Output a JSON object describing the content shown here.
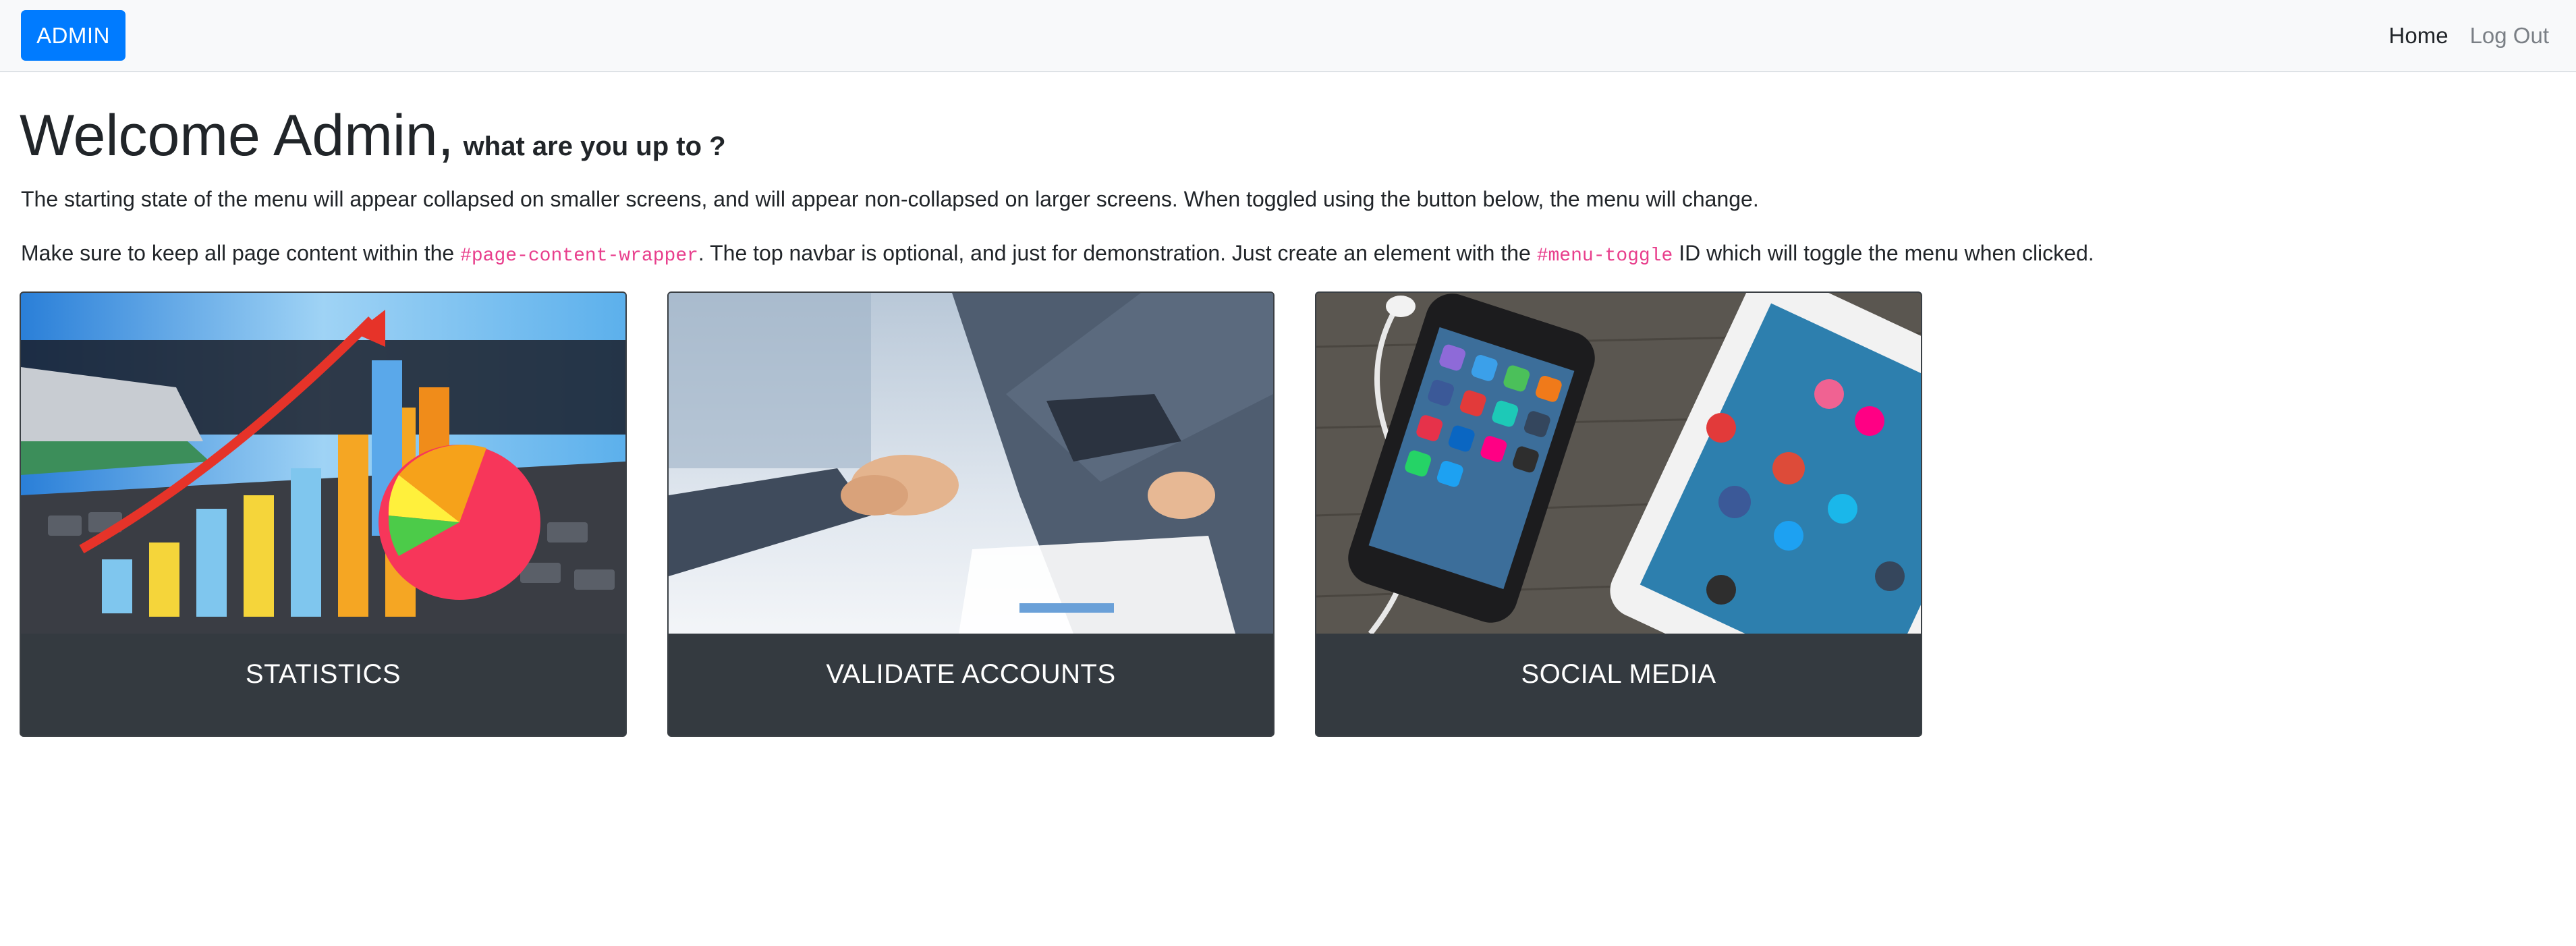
{
  "navbar": {
    "brand_button": "ADMIN",
    "links": [
      {
        "label": "Home"
      },
      {
        "label": "Log Out"
      }
    ]
  },
  "header": {
    "title": "Welcome Admin,",
    "subtitle": "what are you up to ?"
  },
  "intro": {
    "paragraph1": "The starting state of the menu will appear collapsed on smaller screens, and will appear non-collapsed on larger screens. When toggled using the button below, the menu will change.",
    "paragraph2_before": "Make sure to keep all page content within the ",
    "paragraph2_code1": "#page-content-wrapper",
    "paragraph2_middle": ". The top navbar is optional, and just for demonstration. Just create an element with the ",
    "paragraph2_code2": "#menu-toggle",
    "paragraph2_after": " ID which will toggle the menu when clicked."
  },
  "cards": [
    {
      "label": "STATISTICS",
      "image": "statistics-chart-illustration"
    },
    {
      "label": "VALIDATE ACCOUNTS",
      "image": "business-handshake-photo"
    },
    {
      "label": "SOCIAL MEDIA",
      "image": "phone-and-tablet-social-apps-photo"
    }
  ],
  "colors": {
    "primary": "#007bff",
    "navbar_bg": "#f8f9fa",
    "card_footer": "#343a40",
    "code": "#e83e8c"
  }
}
